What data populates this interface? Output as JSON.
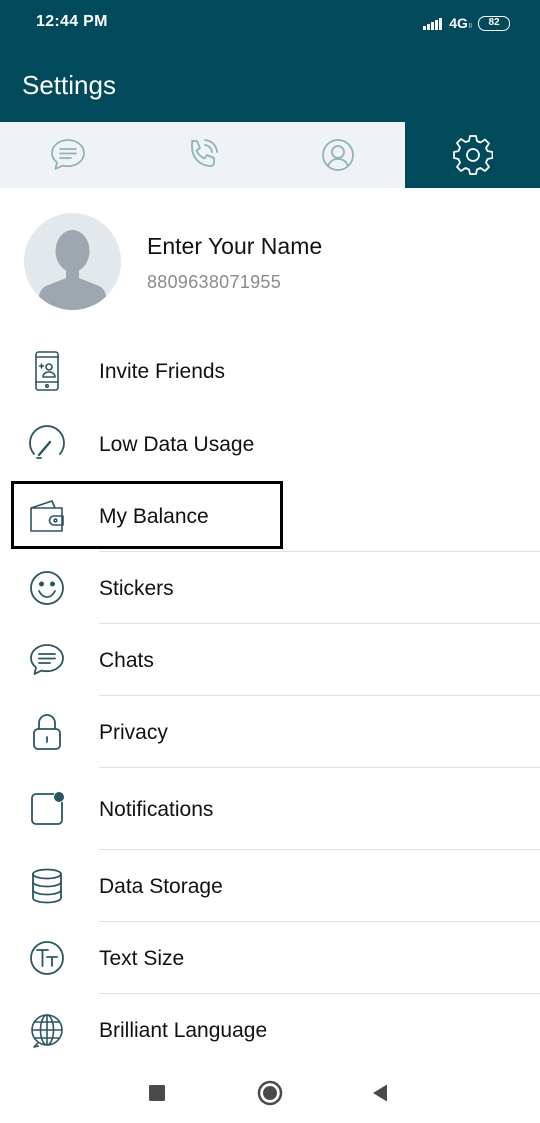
{
  "status": {
    "time": "12:44 PM",
    "network": "4G",
    "network_sub": "ll",
    "battery": "82"
  },
  "header": {
    "title": "Settings"
  },
  "tabs": [
    {
      "icon": "chat-bubble-icon"
    },
    {
      "icon": "phone-icon"
    },
    {
      "icon": "contact-icon"
    },
    {
      "icon": "gear-icon",
      "active": true
    }
  ],
  "profile": {
    "name": "Enter Your Name",
    "phone": "8809638071955"
  },
  "menu": [
    {
      "label": "Invite Friends",
      "icon": "invite-phone-icon"
    },
    {
      "label": "Low Data Usage",
      "icon": "gauge-icon"
    },
    {
      "label": "My Balance",
      "icon": "wallet-icon",
      "highlighted": true
    },
    {
      "label": "Stickers",
      "icon": "smiley-icon"
    },
    {
      "label": "Chats",
      "icon": "chat-bubble-icon"
    },
    {
      "label": "Privacy",
      "icon": "lock-icon"
    },
    {
      "label": "Notifications",
      "icon": "notification-icon"
    },
    {
      "label": "Data Storage",
      "icon": "database-icon"
    },
    {
      "label": "Text Size",
      "icon": "text-size-icon"
    },
    {
      "label": "Brilliant Language",
      "icon": "globe-icon"
    }
  ],
  "navbar": [
    "square-icon",
    "circle-icon",
    "back-triangle-icon"
  ],
  "colors": {
    "primary": "#004a5c",
    "tab_bg": "#f0f3f6",
    "icon_stroke": "#2a5562",
    "highlight_border": "#000000"
  }
}
